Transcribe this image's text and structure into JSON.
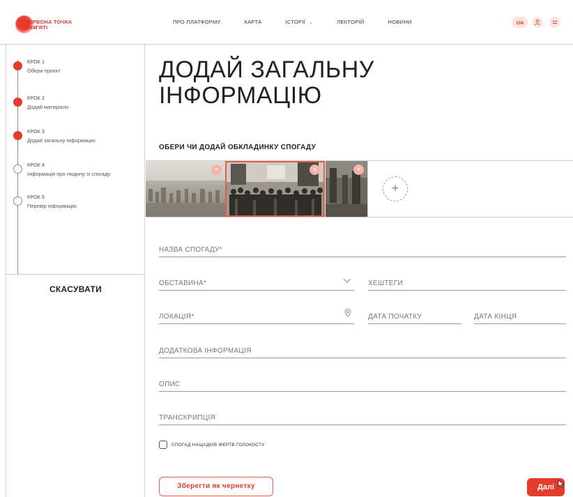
{
  "header": {
    "logo_text": "ЧЕРВОНА ТОЧКА ПАМ'ЯТІ",
    "nav": [
      {
        "label": "ПРО ПЛАТФОРМУ",
        "has_dropdown": false
      },
      {
        "label": "КАРТА",
        "has_dropdown": false
      },
      {
        "label": "ІСТОРІЇ",
        "has_dropdown": true
      },
      {
        "label": "ЛЕКТОРІЙ",
        "has_dropdown": false
      },
      {
        "label": "НОВИНИ",
        "has_dropdown": false
      }
    ],
    "lang": "UA",
    "icons": [
      "user-icon",
      "menu-icon"
    ]
  },
  "sidebar": {
    "steps": [
      {
        "title": "КРОК 1",
        "subtitle": "Обери проєкт",
        "state": "done"
      },
      {
        "title": "КРОК 2",
        "subtitle": "Додай матеріали",
        "state": "done"
      },
      {
        "title": "КРОК 3",
        "subtitle": "Додай загальну інформацію",
        "state": "current"
      },
      {
        "title": "КРОК 4",
        "subtitle": "Інформація про людину зі спогаду",
        "state": "pending"
      },
      {
        "title": "КРОК 5",
        "subtitle": "Перевір інформацію",
        "state": "pending"
      }
    ],
    "cancel_label": "СКАСУВАТИ"
  },
  "main": {
    "title_line1": "ДОДАЙ ЗАГАЛЬНУ",
    "title_line2": "ІНФОРМАЦІЮ",
    "cover_label": "ОБЕРИ ЧИ ДОДАЙ ОБКЛАДИНКУ СПОГАДУ",
    "covers": [
      {
        "selected": false,
        "remove_icon": "close-icon"
      },
      {
        "selected": true,
        "remove_icon": "close-icon"
      },
      {
        "selected": false,
        "remove_icon": "close-icon"
      }
    ],
    "add_cover_icon": "plus-icon",
    "add_cover_symbol": "+",
    "fields": {
      "memory_name": "НАЗВА СПОГАДУ*",
      "circumstance": "ОБСТАВИНА*",
      "hashtags": "ХЕШТЕГИ",
      "location": "ЛОКАЦІЯ*",
      "start_date": "ДАТА ПОЧАТКУ",
      "end_date": "ДАТА КІНЦЯ",
      "additional_info": "ДОДАТКОВА ІНФОРМАЦІЯ",
      "description": "ОПИС",
      "transcription": "ТРАНСКРИПЦІЯ"
    },
    "checkbox_label": "СПОГАД НАЩАДКІВ ЖЕРТВ ГОЛОКОСТУ",
    "checkbox_checked": false,
    "draft_button": "Зберегти як чернетку",
    "next_button": "Далі"
  },
  "colors": {
    "accent": "#e33b2c",
    "accent_light": "#fde6e2",
    "border": "#cfcfcf",
    "text": "#1e1e1e"
  }
}
